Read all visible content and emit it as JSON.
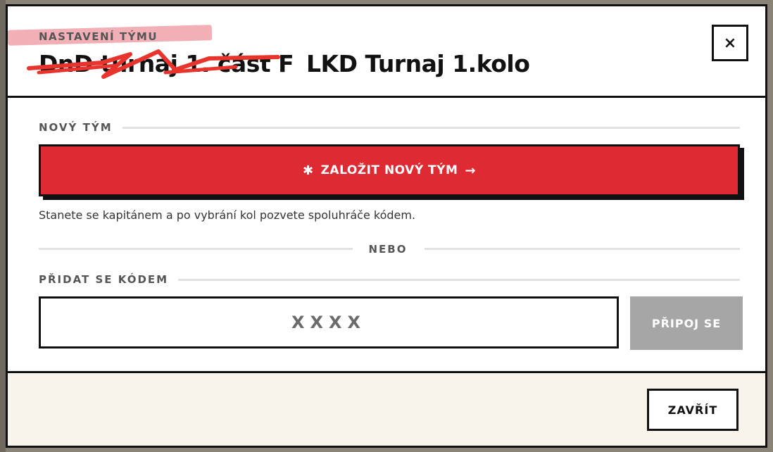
{
  "modal": {
    "eyebrow": "NASTAVENÍ TÝMU",
    "old_title": "DnD turnaj 1. část F",
    "title": "LKD Turnaj 1.kolo",
    "close_icon": "×"
  },
  "new_team": {
    "label": "NOVÝ TÝM",
    "button_icon": "✱",
    "button_label": "ZALOŽIT NOVÝ TÝM",
    "button_arrow": "→",
    "helper": "Stanete se kapitánem a po vybrání kol pozvete spoluhráče kódem."
  },
  "divider": {
    "label": "NEBO"
  },
  "join": {
    "label": "PŘIDAT SE KÓDEM",
    "placeholder": "XXXX",
    "button_label": "PŘIPOJ SE"
  },
  "footer": {
    "close_label": "ZAVŘÍT"
  },
  "colors": {
    "accent_red": "#e02a33",
    "disabled_gray": "#a6a6a6",
    "footer_bg": "#f8f4ec",
    "highlight_pink": "#e86e78"
  },
  "icons": {
    "close": "close-icon",
    "create": "asterisk-icon",
    "arrow": "arrow-right-icon",
    "scribble": "strikethrough-scribble"
  }
}
